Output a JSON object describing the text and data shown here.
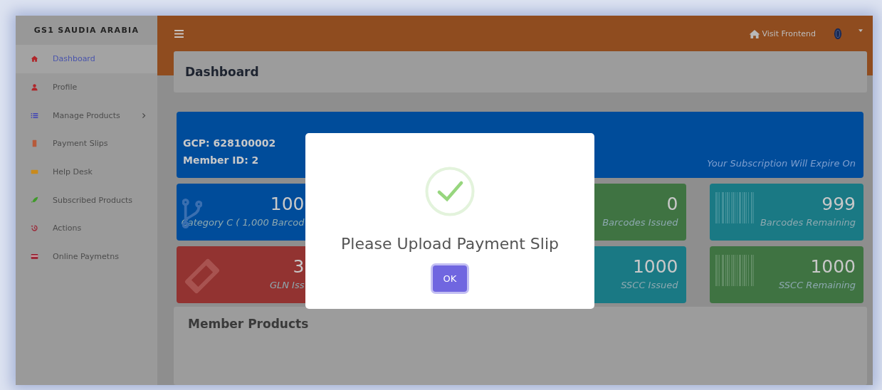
{
  "sidebar": {
    "brand": "GS1 SAUDIA ARABIA",
    "items": [
      {
        "label": "Dashboard",
        "selected": true
      },
      {
        "label": "Profile",
        "selected": false
      },
      {
        "label": "Manage Products",
        "selected": false
      },
      {
        "label": "Payment Slips",
        "selected": false
      },
      {
        "label": "Help Desk",
        "selected": false
      },
      {
        "label": "Subscribed Products",
        "selected": false
      },
      {
        "label": "Actions",
        "selected": false
      },
      {
        "label": "Online Paymetns",
        "selected": false
      }
    ]
  },
  "topbar": {
    "link": "Visit Frontend"
  },
  "page_title": "Dashboard",
  "info": {
    "lines": [
      "GCP: 628100002",
      "Member ID: 2"
    ],
    "note": "Your Subscription Will Expire On"
  },
  "stats": [
    {
      "value": "100",
      "label": "Category C ( 1,000 Barcod",
      "color": "#004c9a"
    },
    {
      "value": "0",
      "label": "Barcodes Issued",
      "color": "#3f7342"
    },
    {
      "value": "999",
      "label": "Barcodes Remaining",
      "color": "#1a7984"
    },
    {
      "value": "3",
      "label": "GLN Iss",
      "color": "#923331"
    },
    {
      "value": "1000",
      "label": "SSCC Issued",
      "color": "#1a7984"
    },
    {
      "value": "1000",
      "label": "SSCC Remaining",
      "color": "#3f7342"
    }
  ],
  "panel": {
    "title": "Member Products"
  },
  "dialog": {
    "message": "Please Upload Payment Slip",
    "button": "OK"
  }
}
